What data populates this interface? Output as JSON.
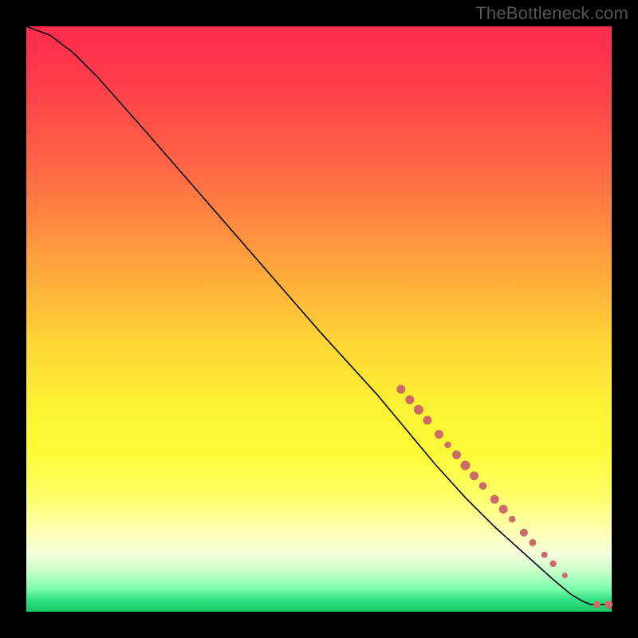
{
  "watermark": "TheBottleneck.com",
  "colors": {
    "dot": "#cc6b68",
    "line": "#000000",
    "bg": "#000000"
  },
  "chart_data": {
    "type": "line",
    "title": "",
    "xlabel": "",
    "ylabel": "",
    "xlim": [
      0,
      100
    ],
    "ylim": [
      0,
      100
    ],
    "grid": false,
    "legend": false,
    "background_gradient": {
      "orientation": "vertical",
      "stops": [
        {
          "pos": 0.0,
          "color": "#ff2b4e"
        },
        {
          "pos": 0.25,
          "color": "#ff6a45"
        },
        {
          "pos": 0.45,
          "color": "#ffb43a"
        },
        {
          "pos": 0.65,
          "color": "#fbf233"
        },
        {
          "pos": 0.8,
          "color": "#ffff66"
        },
        {
          "pos": 0.9,
          "color": "#f6ffdc"
        },
        {
          "pos": 0.96,
          "color": "#7fffb0"
        },
        {
          "pos": 1.0,
          "color": "#18c968"
        }
      ]
    },
    "series": [
      {
        "name": "curve",
        "kind": "line",
        "points": [
          {
            "x": 0,
            "y": 100
          },
          {
            "x": 4,
            "y": 98.5
          },
          {
            "x": 8,
            "y": 95.5
          },
          {
            "x": 12,
            "y": 91.5
          },
          {
            "x": 20,
            "y": 82.5
          },
          {
            "x": 30,
            "y": 71
          },
          {
            "x": 40,
            "y": 59.5
          },
          {
            "x": 50,
            "y": 48
          },
          {
            "x": 60,
            "y": 37
          },
          {
            "x": 65,
            "y": 31
          },
          {
            "x": 70,
            "y": 25
          },
          {
            "x": 75,
            "y": 19.5
          },
          {
            "x": 80,
            "y": 14.5
          },
          {
            "x": 85,
            "y": 10
          },
          {
            "x": 90,
            "y": 5.5
          },
          {
            "x": 93,
            "y": 3
          },
          {
            "x": 95,
            "y": 1.8
          },
          {
            "x": 96.5,
            "y": 1.2
          },
          {
            "x": 98.5,
            "y": 1.2
          },
          {
            "x": 100,
            "y": 1.2
          }
        ]
      },
      {
        "name": "dots",
        "kind": "scatter",
        "points": [
          {
            "x": 64,
            "y": 38,
            "r": 5.5
          },
          {
            "x": 65.5,
            "y": 36.2,
            "r": 5.5
          },
          {
            "x": 67,
            "y": 34.5,
            "r": 6.0
          },
          {
            "x": 68.5,
            "y": 32.7,
            "r": 5.5
          },
          {
            "x": 70.5,
            "y": 30.3,
            "r": 5.5
          },
          {
            "x": 72,
            "y": 28.5,
            "r": 4.2
          },
          {
            "x": 73.5,
            "y": 26.8,
            "r": 5.5
          },
          {
            "x": 75,
            "y": 25,
            "r": 6.0
          },
          {
            "x": 76.5,
            "y": 23.2,
            "r": 5.5
          },
          {
            "x": 78,
            "y": 21.5,
            "r": 4.8
          },
          {
            "x": 80,
            "y": 19.2,
            "r": 5.5
          },
          {
            "x": 81.5,
            "y": 17.5,
            "r": 5.5
          },
          {
            "x": 83,
            "y": 15.8,
            "r": 4.2
          },
          {
            "x": 85,
            "y": 13.5,
            "r": 5.0
          },
          {
            "x": 86.5,
            "y": 11.8,
            "r": 4.5
          },
          {
            "x": 88.5,
            "y": 9.7,
            "r": 4.0
          },
          {
            "x": 90,
            "y": 8.2,
            "r": 4.2
          },
          {
            "x": 92,
            "y": 6.2,
            "r": 3.5
          },
          {
            "x": 97.5,
            "y": 1.2,
            "r": 4.5
          },
          {
            "x": 99.5,
            "y": 1.2,
            "r": 5.0
          }
        ]
      }
    ]
  }
}
